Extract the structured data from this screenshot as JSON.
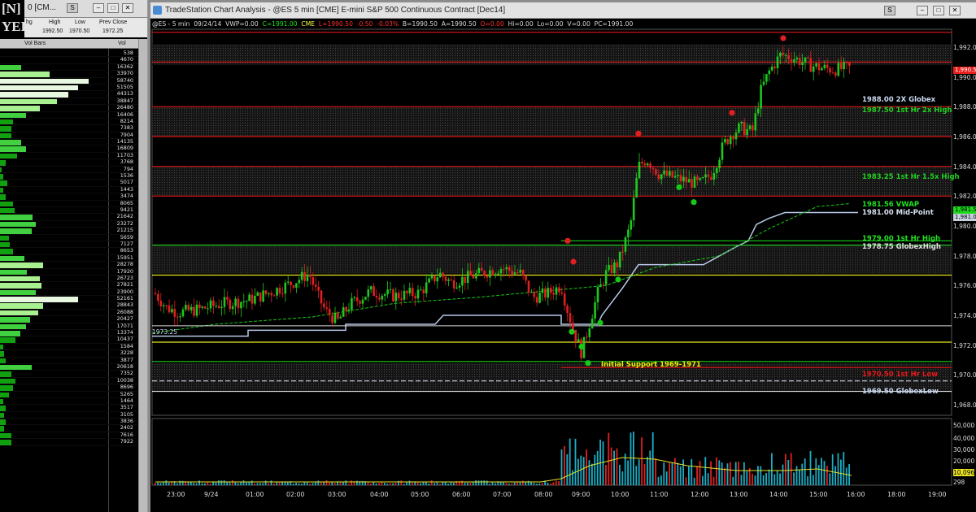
{
  "left_window": {
    "logo_text": "[N]\nYER",
    "title": "0 [CM...",
    "quote_headers": {
      "chg": "hg",
      "high": "High",
      "low": "Low",
      "prev_close": "Prev Close"
    },
    "quote_values": {
      "high": "1992.50",
      "low": "1970.50",
      "prev_close": "1972.25"
    },
    "col_vol_bars": "Vol Bars",
    "col_vol": "Vol",
    "rows": [
      {
        "vol": "538",
        "bar": 0
      },
      {
        "vol": "4670",
        "bar": 0
      },
      {
        "vol": "16362",
        "bar": 0.15
      },
      {
        "vol": "33970",
        "bar": 0.35
      },
      {
        "vol": "58740",
        "bar": 0.62
      },
      {
        "vol": "51505",
        "bar": 0.55
      },
      {
        "vol": "44313",
        "bar": 0.48
      },
      {
        "vol": "38847",
        "bar": 0.4
      },
      {
        "vol": "26480",
        "bar": 0.28
      },
      {
        "vol": "16406",
        "bar": 0.18
      },
      {
        "vol": "8214",
        "bar": 0.09
      },
      {
        "vol": "7383",
        "bar": 0.08
      },
      {
        "vol": "7904",
        "bar": 0.08
      },
      {
        "vol": "14135",
        "bar": 0.15
      },
      {
        "vol": "16809",
        "bar": 0.18
      },
      {
        "vol": "11703",
        "bar": 0.12
      },
      {
        "vol": "3768",
        "bar": 0.04
      },
      {
        "vol": "794",
        "bar": 0.01
      },
      {
        "vol": "1536",
        "bar": 0.02
      },
      {
        "vol": "5017",
        "bar": 0.05
      },
      {
        "vol": "1443",
        "bar": 0.02
      },
      {
        "vol": "3474",
        "bar": 0.04
      },
      {
        "vol": "8065",
        "bar": 0.09
      },
      {
        "vol": "9421",
        "bar": 0.1
      },
      {
        "vol": "21642",
        "bar": 0.23
      },
      {
        "vol": "23272",
        "bar": 0.25
      },
      {
        "vol": "21215",
        "bar": 0.22
      },
      {
        "vol": "5659",
        "bar": 0.06
      },
      {
        "vol": "7127",
        "bar": 0.07
      },
      {
        "vol": "8653",
        "bar": 0.09
      },
      {
        "vol": "15951",
        "bar": 0.17
      },
      {
        "vol": "28278",
        "bar": 0.3
      },
      {
        "vol": "17920",
        "bar": 0.19
      },
      {
        "vol": "26723",
        "bar": 0.28
      },
      {
        "vol": "27821",
        "bar": 0.29
      },
      {
        "vol": "23900",
        "bar": 0.25
      },
      {
        "vol": "52161",
        "bar": 0.55
      },
      {
        "vol": "28843",
        "bar": 0.3
      },
      {
        "vol": "26088",
        "bar": 0.27
      },
      {
        "vol": "20427",
        "bar": 0.21
      },
      {
        "vol": "17071",
        "bar": 0.18
      },
      {
        "vol": "13374",
        "bar": 0.14
      },
      {
        "vol": "10437",
        "bar": 0.11
      },
      {
        "vol": "1584",
        "bar": 0.02
      },
      {
        "vol": "3228",
        "bar": 0.03
      },
      {
        "vol": "3877",
        "bar": 0.04
      },
      {
        "vol": "20618",
        "bar": 0.22
      },
      {
        "vol": "7352",
        "bar": 0.08
      },
      {
        "vol": "10038",
        "bar": 0.11
      },
      {
        "vol": "8696",
        "bar": 0.09
      },
      {
        "vol": "5265",
        "bar": 0.06
      },
      {
        "vol": "1464",
        "bar": 0.02
      },
      {
        "vol": "3517",
        "bar": 0.04
      },
      {
        "vol": "3105",
        "bar": 0.03
      },
      {
        "vol": "3836",
        "bar": 0.04
      },
      {
        "vol": "2402",
        "bar": 0.03
      },
      {
        "vol": "7616",
        "bar": 0.08
      },
      {
        "vol": "7922",
        "bar": 0.08
      }
    ]
  },
  "chart_window": {
    "title": "TradeStation Chart Analysis - @ES 5 min [CME] E-mini S&P 500 Continuous Contract [Dec14]",
    "status": {
      "symbol": "@ES - 5 min",
      "date": "09/24/14",
      "vwp": "VWP=0.00",
      "close": "C=1991.00",
      "exch": "CME",
      "last": "L=1990.50",
      "chg": "-0.50",
      "pct": "-0.03%",
      "bid": "B=1990.50",
      "ask": "A=1990.50",
      "o": "O=0.00",
      "hi": "Hi=0.00",
      "lo": "Lo=0.00",
      "v": "V=0.00",
      "pc": "PC=1991.00"
    },
    "price_axis": [
      "1,992.0",
      "1,990.0",
      "1,988.0",
      "1,986.0",
      "1,984.0",
      "1,982.0",
      "1,980.0",
      "1,978.0",
      "1,976.0",
      "1,974.0",
      "1,972.0",
      "1,970.0",
      "1,968.0"
    ],
    "price_tags": [
      "1,990.5",
      "1,981.5",
      "1,981.0"
    ],
    "volume_axis": [
      "50,000",
      "40,000",
      "30,000",
      "20,000",
      "10,096",
      "298"
    ],
    "time_axis": [
      "23:00",
      "9/24",
      "01:00",
      "02:00",
      "03:00",
      "04:00",
      "05:00",
      "06:00",
      "07:00",
      "08:00",
      "09:00",
      "10:00",
      "11:00",
      "12:00",
      "13:00",
      "14:00",
      "15:00",
      "16:00",
      "18:00",
      "19:00"
    ],
    "levels": {
      "globex_2x": "1988.00 2X Globex",
      "first_hr_2x": "1987.50 1st Hr 2x High",
      "first_hr_15x": "1983.25 1st Hr 1.5x High",
      "vwap": "1981.56 VWAP",
      "midpoint": "1981.00 Mid-Point",
      "first_hr_high": "1979.00 1st Hr High",
      "globex_high": "1978.75 GlobexHigh",
      "initial_support": "Initial Support 1969-1971",
      "first_hr_low": "1970.50 1st Hr Low",
      "globex_low": "1969.50 GlobexLow",
      "left_tag": "1973.25"
    },
    "colors": {
      "up": "#1ec81e",
      "down": "#e02020",
      "resistance": "#e01414",
      "support_green": "#18d018",
      "yellow": "#e8e81e",
      "vwap": "#18c818",
      "midpoint": "#b8c8e8"
    }
  }
}
